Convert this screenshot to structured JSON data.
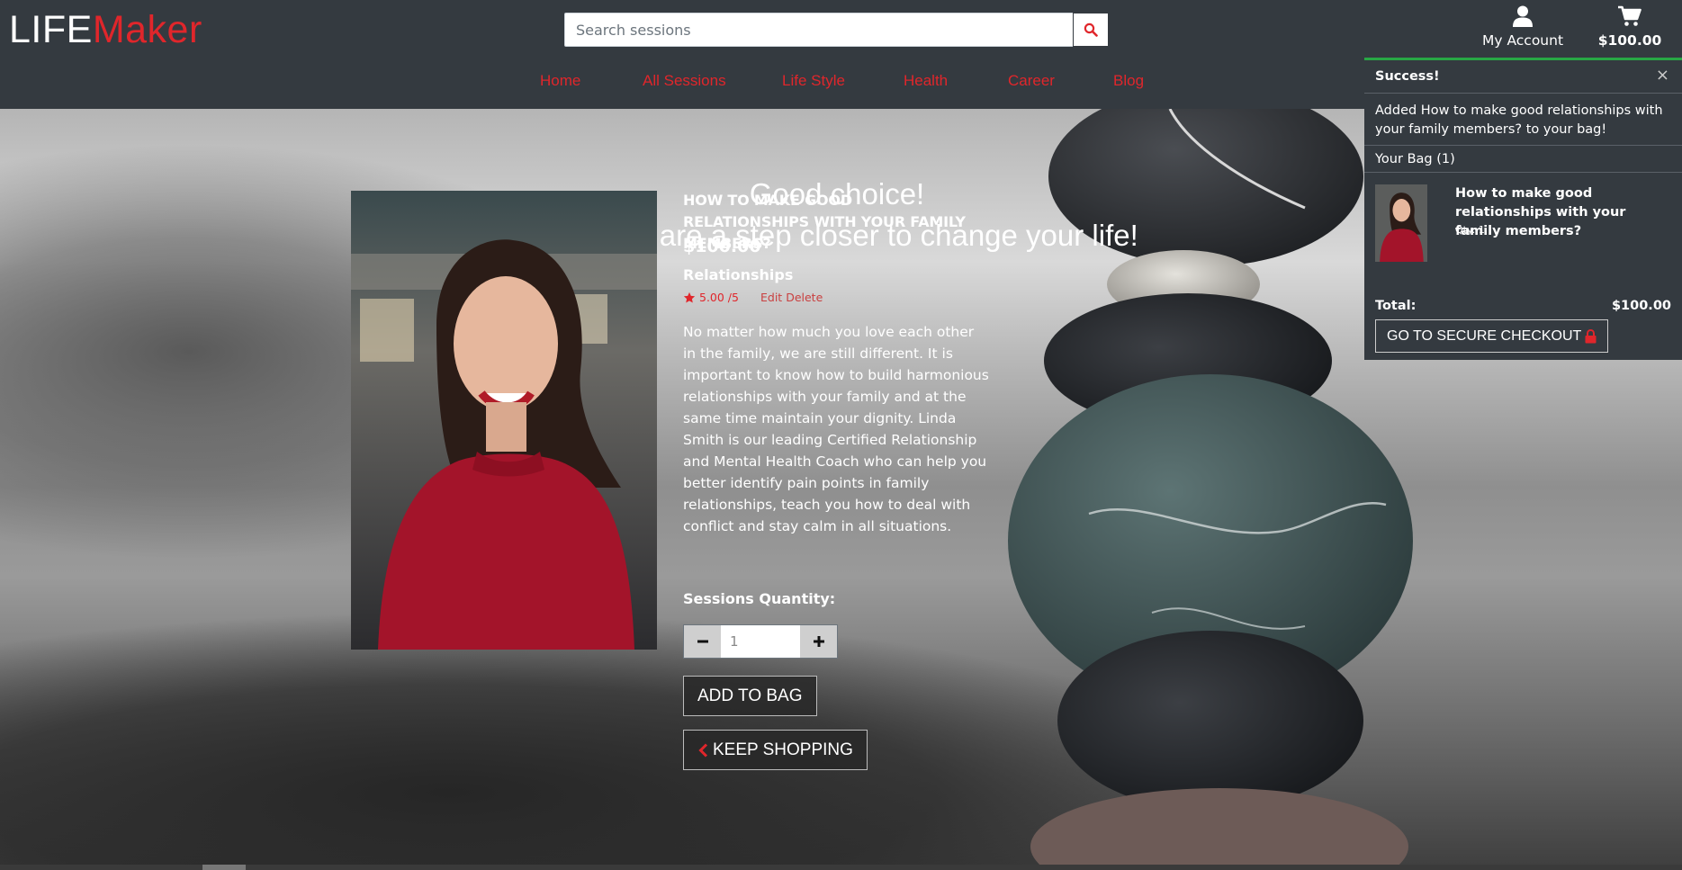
{
  "brand": {
    "part1": "LIFE",
    "part2": "Maker"
  },
  "search": {
    "placeholder": "Search sessions"
  },
  "account": {
    "label": "My Account"
  },
  "cart": {
    "total": "$100.00"
  },
  "nav": [
    "Home",
    "All Sessions",
    "Life Style",
    "Health",
    "Career",
    "Blog"
  ],
  "hero": {
    "line1": "Good choice!",
    "line2": "Now you are a step closer to change your life!"
  },
  "product": {
    "name": "HOW TO MAKE GOOD RELATIONSHIPS WITH YOUR FAMILY MEMBERS?",
    "price": "$100.00",
    "category": "Relationships",
    "rating": "5.00 /5",
    "edit_label": "Edit",
    "delete_label": "Delete",
    "description": "No matter how much you love each other in the family, we are still different. It is important to know how to build harmonious relationships with your family and at the same time maintain your dignity. Linda Smith is our leading Certified Relationship and Mental Health Coach who can help you better identify pain points in family relationships, teach you how to deal with conflict and stay calm in all situations.",
    "quantity_label": "Sessions Quantity:",
    "quantity": "1",
    "add_to_bag": "ADD TO BAG",
    "keep_shopping": "KEEP SHOPPING"
  },
  "toast": {
    "title": "Success!",
    "close": "×",
    "message": "Added How to make good relationships with your family members? to your bag!",
    "bag_label": "Your Bag (1)",
    "item_name": "How to make good relationships with your family members?",
    "item_qty": "Qty: 1",
    "total_label": "Total:",
    "total_value": "$100.00",
    "checkout": "GO TO SECURE CHECKOUT"
  },
  "colors": {
    "accent": "#e0262b",
    "header": "#343a40",
    "success": "#28a745"
  },
  "icons": [
    "search-icon",
    "user-icon",
    "cart-icon",
    "star-icon",
    "minus-icon",
    "plus-icon",
    "chevron-left-icon",
    "lock-icon",
    "close-icon"
  ]
}
